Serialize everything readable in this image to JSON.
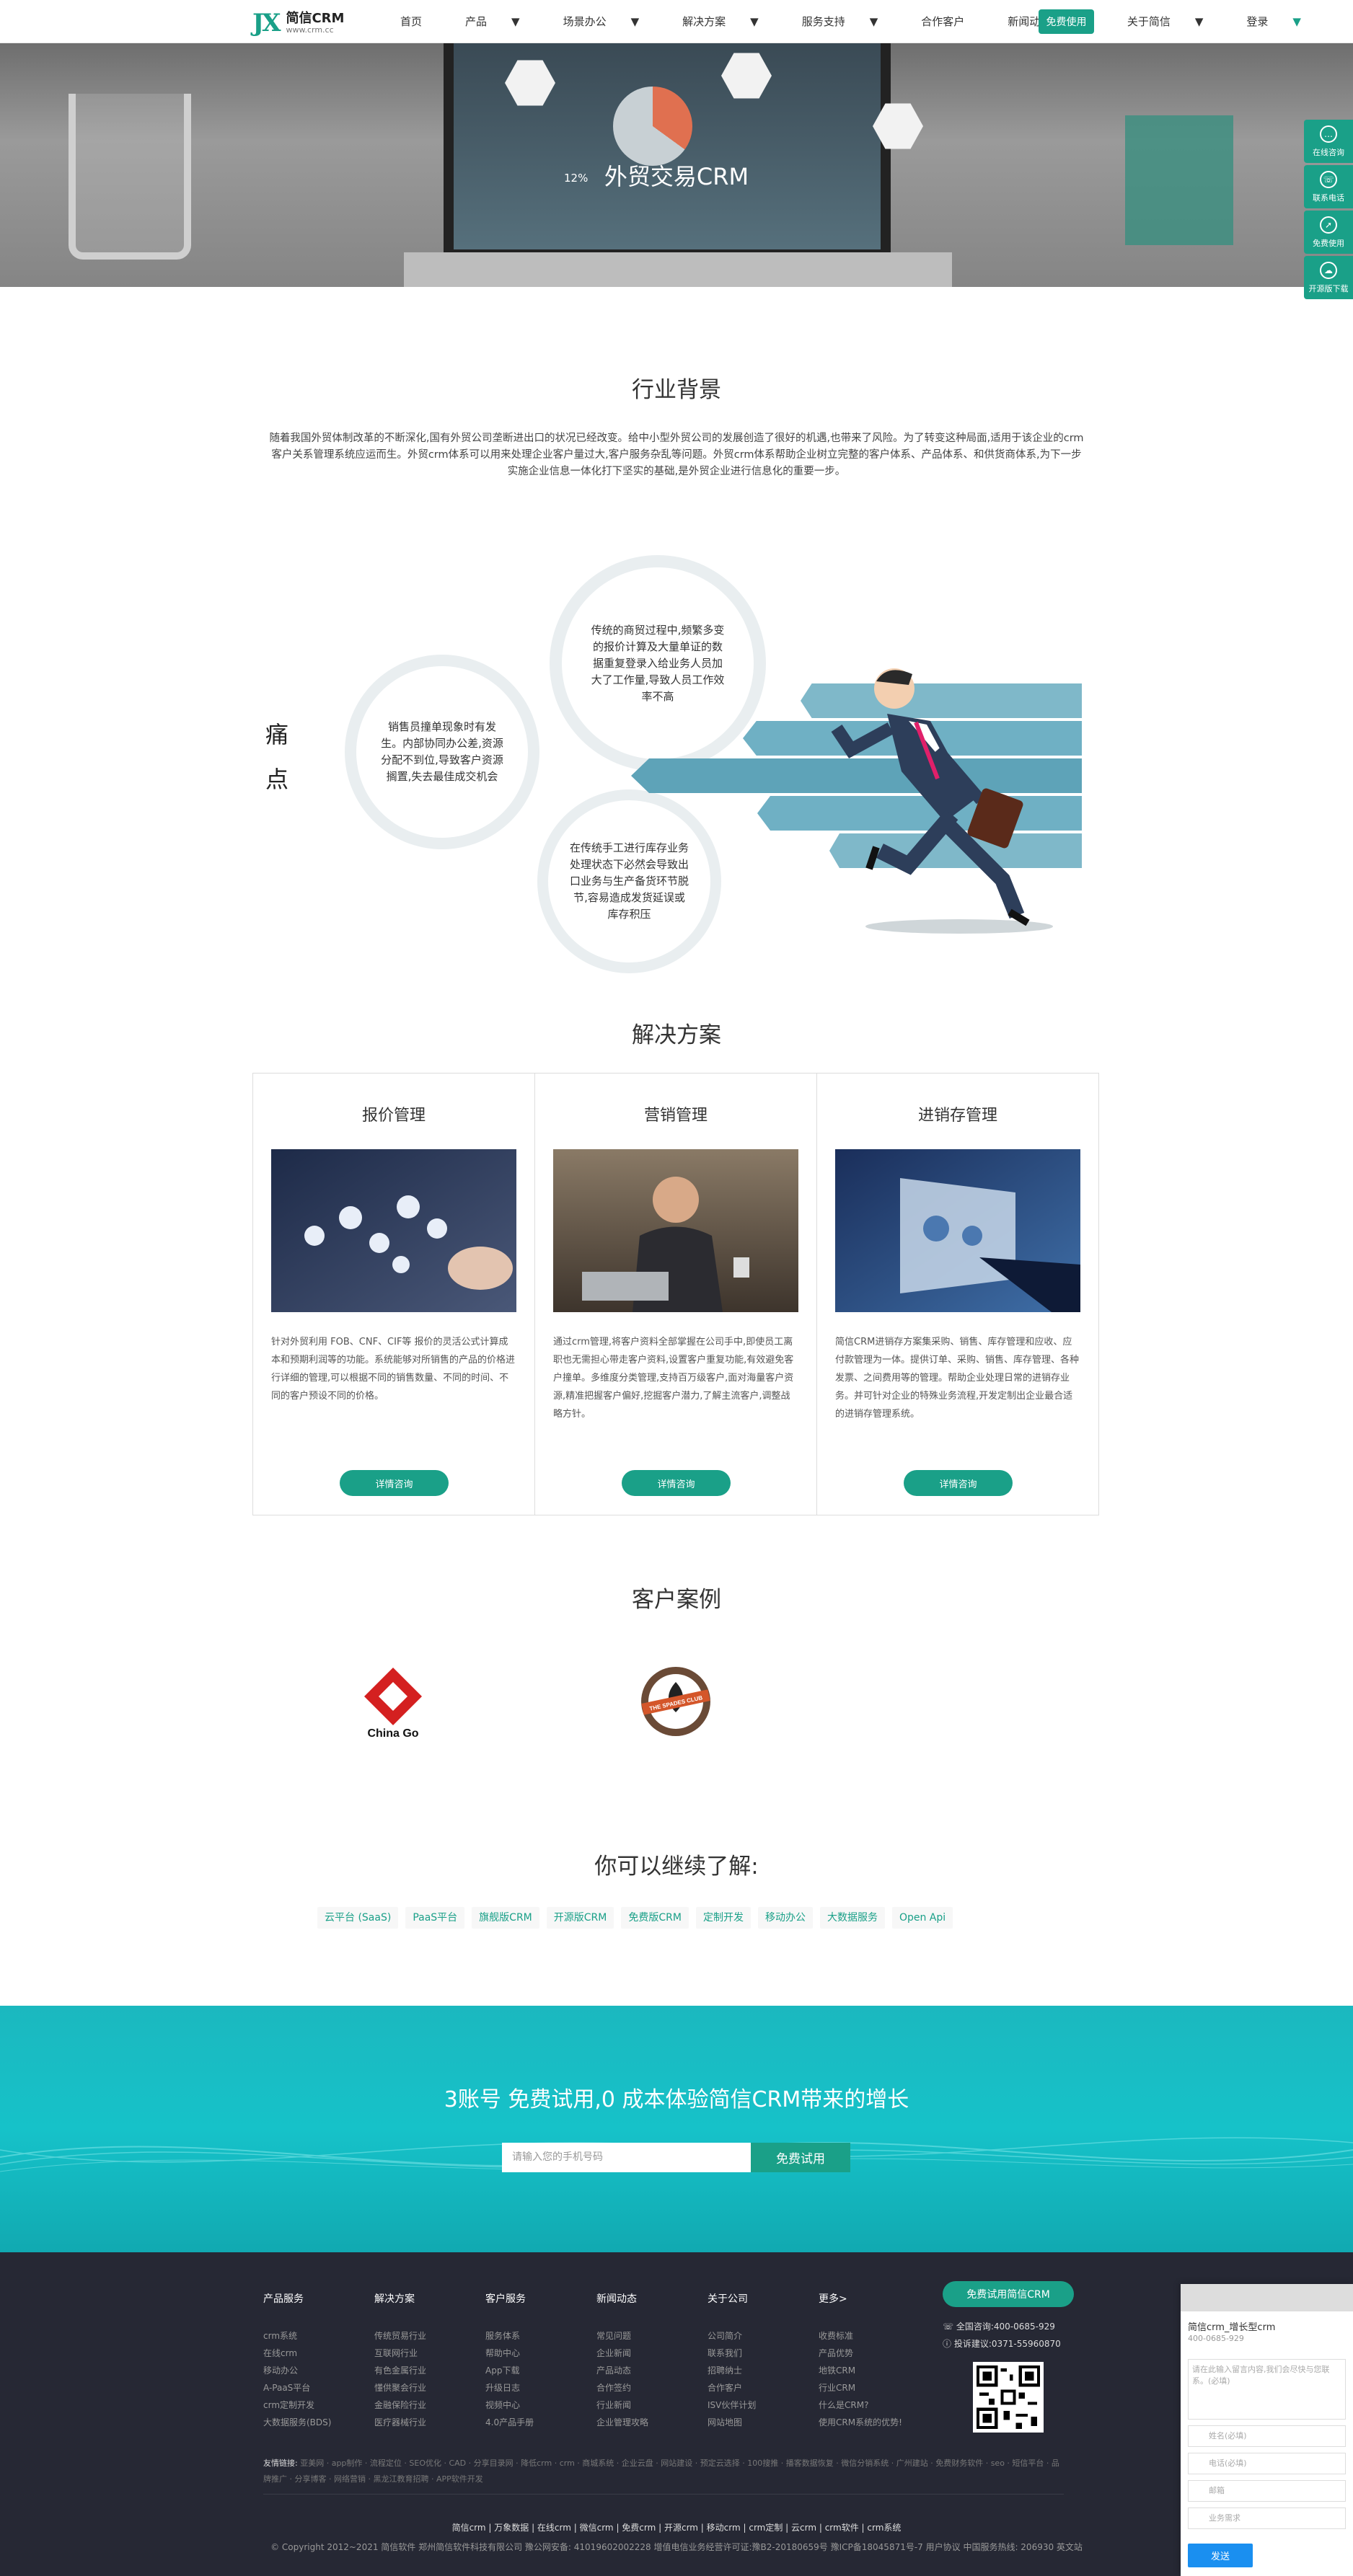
{
  "header": {
    "logo_mark": "JX",
    "logo_name": "简信CRM",
    "logo_url": "www.crm.cc",
    "nav": [
      {
        "label": "首页",
        "caret": false
      },
      {
        "label": "产品",
        "caret": true
      },
      {
        "label": "场景办公",
        "caret": true
      },
      {
        "label": "解决方案",
        "caret": true
      },
      {
        "label": "服务支持",
        "caret": true
      },
      {
        "label": "合作客户",
        "caret": false
      },
      {
        "label": "新闻动态",
        "caret": true
      },
      {
        "label": "关于简信",
        "caret": true
      },
      {
        "label": "登录",
        "caret": true
      }
    ],
    "free_button": "免费使用"
  },
  "hero": {
    "title": "外贸交易CRM",
    "percent": "12%"
  },
  "side_tools": [
    {
      "label": "在线咨询",
      "icon": "chat-icon"
    },
    {
      "label": "联系电话",
      "icon": "phone-icon"
    },
    {
      "label": "免费使用",
      "icon": "compass-icon"
    },
    {
      "label": "开源版下载",
      "icon": "cloud-download-icon"
    }
  ],
  "background": {
    "title": "行业背景",
    "text": "随着我国外贸体制改革的不断深化,国有外贸公司垄断进出口的状况已经改变。给中小型外贸公司的发展创造了很好的机遇,也带来了风险。为了转变这种局面,适用于该企业的crm客户关系管理系统应运而生。外贸crm体系可以用来处理企业客户量过大,客户服务杂乱等问题。外贸crm体系帮助企业树立完整的客户体系、产品体系、和供货商体系,为下一步实施企业信息一体化打下坚实的基础,是外贸企业进行信息化的重要一步。"
  },
  "pain": {
    "label": "痛点",
    "points": [
      "销售员撞单现象时有发生。内部协同办公差,资源分配不到位,导致客户资源搁置,失去最佳成交机会",
      "传统的商贸过程中,频繁多变的报价计算及大量单证的数据重复登录入给业务人员加大了工作量,导致人员工作效率不高",
      "在传统手工进行库存业务处理状态下必然会导致出口业务与生产备货环节脱节,容易造成发货延误或库存积压"
    ]
  },
  "solutions": {
    "title": "解决方案",
    "cards": [
      {
        "title": "报价管理",
        "text": "针对外贸利用 FOB、CNF、CIF等 报价的灵活公式计算成本和预期利润等的功能。系统能够对所销售的产品的价格进行详细的管理,可以根据不同的销售数量、不同的时间、不同的客户预设不同的价格。",
        "button": "详情咨询"
      },
      {
        "title": "营销管理",
        "text": "通过crm管理,将客户资料全部掌握在公司手中,即使员工离职也无需担心带走客户资料,设置客户重复功能,有效避免客户撞单。多维度分类管理,支持百万级客户,面对海量客户资源,精准把握客户偏好,挖掘客户潜力,了解主流客户,调整战略方针。",
        "button": "详情咨询"
      },
      {
        "title": "进销存管理",
        "text": "简信CRM进销存方案集采购、销售、库存管理和应收、应付款管理为一体。提供订单、采购、销售、库存管理、各种发票、之间费用等的管理。帮助企业处理日常的进销存业务。并可针对企业的特殊业务流程,开发定制出企业最合适的进销存管理系统。",
        "button": "详情咨询"
      }
    ]
  },
  "customers": {
    "title": "客户案例",
    "logos": [
      {
        "name": "China Go",
        "icon": "china-go-logo"
      },
      {
        "name": "THE SPADES CLUB",
        "icon": "spades-club-logo"
      }
    ]
  },
  "more": {
    "title": "你可以继续了解:",
    "links": [
      "云平台 (SaaS)",
      "PaaS平台",
      "旗舰版CRM",
      "开源版CRM",
      "免费版CRM",
      "定制开发",
      "移动办公",
      "大数据服务",
      "Open Api"
    ]
  },
  "banner": {
    "title": "3账号 免费试用,0 成本体验简信CRM带来的增长",
    "placeholder": "请输入您的手机号码",
    "button": "免费试用"
  },
  "footer": {
    "columns": [
      {
        "title": "产品服务",
        "items": [
          "crm系统",
          "在线crm",
          "移动办公",
          "A-PaaS平台",
          "crm定制开发",
          "大数据服务(BDS)"
        ]
      },
      {
        "title": "解决方案",
        "items": [
          "传统贸易行业",
          "互联网行业",
          "有色金属行业",
          "懂供聚会行业",
          "金融保险行业",
          "医疗器械行业"
        ]
      },
      {
        "title": "客户服务",
        "items": [
          "服务体系",
          "帮助中心",
          "App下载",
          "升级日志",
          "视频中心",
          "4.0产品手册"
        ]
      },
      {
        "title": "新闻动态",
        "items": [
          "常见问题",
          "企业新闻",
          "产品动态",
          "合作签约",
          "行业新闻",
          "企业管理攻略"
        ]
      },
      {
        "title": "关于公司",
        "items": [
          "公司简介",
          "联系我们",
          "招聘纳士",
          "合作客户",
          "ISV伙伴计划",
          "网站地图"
        ]
      },
      {
        "title": "更多>",
        "items": [
          "收费标准",
          "产品优势",
          "地铁CRM",
          "行业CRM",
          "什么是CRM?",
          "使用CRM系统的优势!"
        ]
      }
    ],
    "trial_button": "免费试用简信CRM",
    "hotline": "全国咨询:400-0685-929",
    "complaint": "投诉建议:0371-55960870",
    "friend_label": "友情链接:",
    "friend_links": "亚美网 · app制作 · 流程定位 · SEO优化 · CAD · 分享目录网 · 降低crm · crm · 商城系统 · 企业云盘 · 网站建设 · 预定云选择 · 100搜推 · 播客数据恢复 · 微信分销系统 · 广州建站 · 免费财务软件 · seo · 短信平台 · 品牌推广 · 分享博客 · 网络营销 · 黑龙江教育招聘 · APP软件开发",
    "bottom_nav": "简信crm | 万象数据 | 在线crm | 微信crm | 免费crm | 开源crm | 移动crm | crm定制 | 云crm | crm软件 | crm系统",
    "copyright": "© Copyright 2012~2021 简信软件 郑州简信软件科技有限公司 豫公网安备: 41019602002228 增值电信业务经营许可证:豫B2-20180659号 豫ICP备18045871号-7 用户协议 中国服务热线: 206930 英文站"
  },
  "message_box": {
    "name": "简信crm_增长型crm",
    "tel": "400-0685-929",
    "textarea_placeholder": "请在此输入留言内容,我们会尽快与您联系。(必填)",
    "fields": [
      "姓名(必填)",
      "电话(必填)",
      "邮箱",
      "业务需求"
    ],
    "send": "发送"
  }
}
